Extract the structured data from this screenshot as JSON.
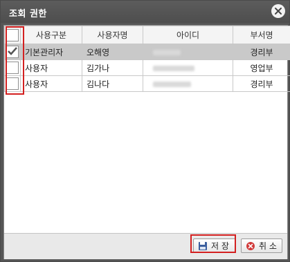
{
  "dialog": {
    "title": "조회 권한",
    "close_icon": "close-icon"
  },
  "table": {
    "columns": [
      "사용구분",
      "사용자명",
      "아이디",
      "부서명"
    ],
    "rows": [
      {
        "checked": true,
        "type": "기본관리자",
        "name": "오해영",
        "dept": "경리부",
        "selected": true
      },
      {
        "checked": false,
        "type": "사용자",
        "name": "김가나",
        "dept": "영업부",
        "selected": false
      },
      {
        "checked": false,
        "type": "사용자",
        "name": "김나다",
        "dept": "경리부",
        "selected": false
      }
    ]
  },
  "footer": {
    "save_label": "저 장",
    "cancel_label": "취 소",
    "save_icon": "floppy-disk-icon",
    "cancel_icon": "cancel-x-icon"
  },
  "colors": {
    "titlebar": "#565656",
    "highlight_outline": "#d32020",
    "selected_row": "#c9c9c9"
  }
}
